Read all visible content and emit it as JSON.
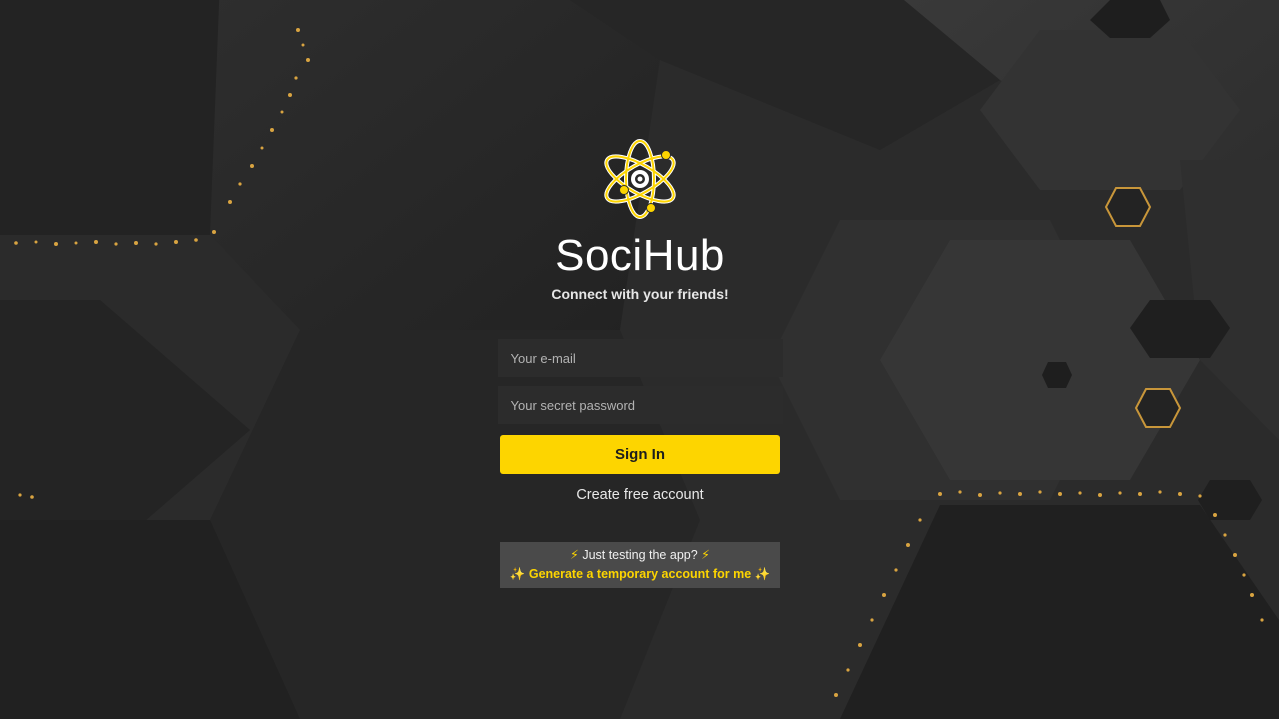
{
  "app": {
    "title": "SociHub",
    "tagline": "Connect with your friends!"
  },
  "login_form": {
    "email_placeholder": "Your e-mail",
    "password_placeholder": "Your secret password",
    "sign_in_label": "Sign In",
    "create_account_label": "Create free account"
  },
  "testing": {
    "prompt_icon": "⚡",
    "prompt": "Just testing the app?",
    "generate_icon": "✨",
    "generate_label": "Generate a temporary account for me"
  },
  "icons": {
    "logo": "atom-logo-icon",
    "prompt": "lightning-icon",
    "generate": "sparkles-icon"
  },
  "colors": {
    "accent": "#fdd500",
    "background": "#262626",
    "field": "#2c2c2c",
    "test_box": "#4a4a4a"
  }
}
